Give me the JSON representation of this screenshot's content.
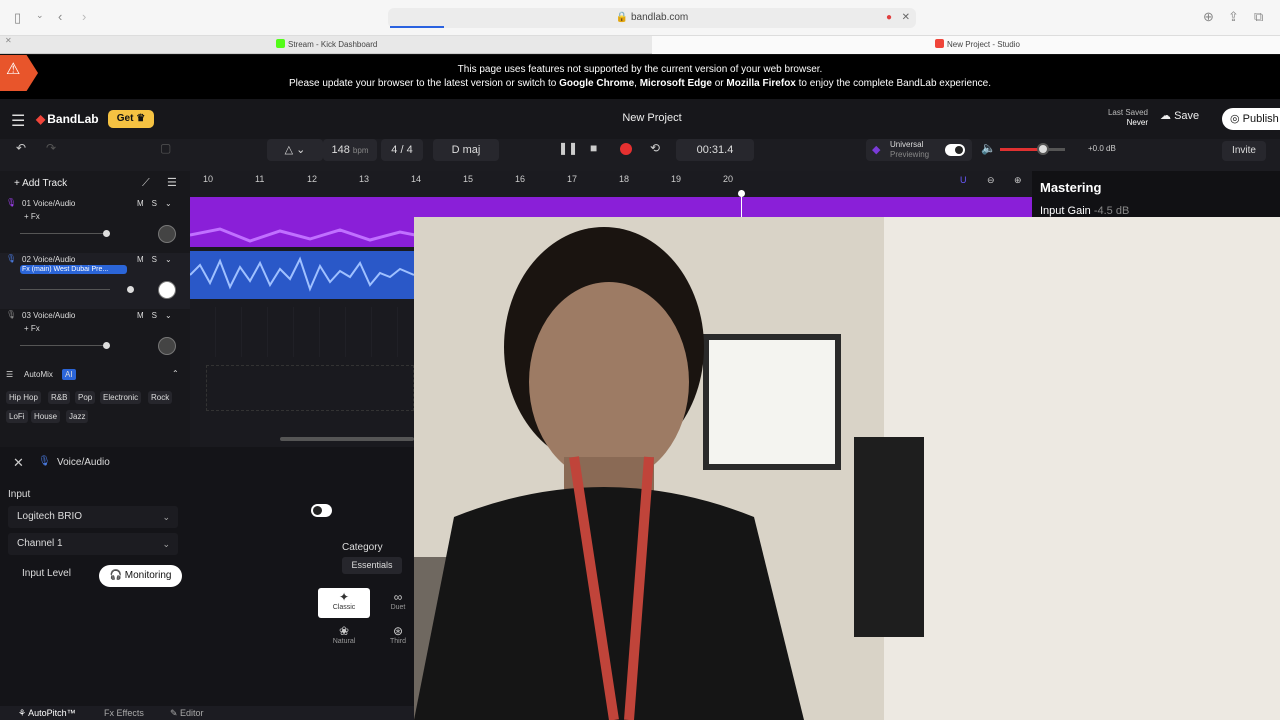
{
  "browser": {
    "url": "bandlab.com",
    "tabs": [
      {
        "title": "Stream - Kick Dashboard",
        "color": "#53fc18"
      },
      {
        "title": "New Project - Studio",
        "color": "#f0453a"
      }
    ]
  },
  "banner": {
    "line1": "This page uses features not supported by the current version of your web browser.",
    "line2_prefix": "Please update your browser to the latest version or switch to",
    "chrome": "Google Chrome",
    "edge": "Microsoft Edge",
    "or": "or",
    "firefox": "Mozilla Firefox",
    "line2_suffix": "to enjoy the complete BandLab experience."
  },
  "topbar": {
    "logo": "BandLab",
    "get_label": "Get",
    "project_title": "New Project",
    "last_saved_label": "Last Saved",
    "last_saved_value": "Never",
    "save_label": "Save",
    "publish_label": "Publish"
  },
  "transport": {
    "bpm": "148",
    "bpm_unit": "bpm",
    "time_sig_num": "4",
    "time_sig_den": "4",
    "key": "D maj",
    "time": "00:31.4",
    "universal_label": "Universal",
    "universal_sub": "Previewing",
    "master_gain": "+0.0 dB",
    "invite_label": "Invite",
    "volume_level": 0.65
  },
  "tracks_panel": {
    "add_track_label": "Add Track",
    "ruler": [
      "10",
      "11",
      "12",
      "13",
      "14",
      "15",
      "16",
      "17",
      "18",
      "19",
      "20"
    ],
    "tracks": [
      {
        "name": "01  Voice/Audio",
        "fx": "+ Fx",
        "fader": 0.95
      },
      {
        "name": "02  Voice/Audio",
        "fx": "Fx (main) West Dubai Pre...",
        "fader": 1.0
      },
      {
        "name": "03  Voice/Audio",
        "fx": "+ Fx",
        "fader": 0.95
      }
    ],
    "mute": "M",
    "solo": "S",
    "automix_label": "AutoMix",
    "ai_badge": "AI",
    "genres": [
      "Hip Hop",
      "R&B",
      "Pop",
      "Electronic",
      "Rock",
      "LoFi",
      "House",
      "Jazz"
    ]
  },
  "mastering": {
    "title": "Mastering",
    "input_gain_label": "Input Gain",
    "input_gain_value": "-4.5 dB"
  },
  "bottom_panel": {
    "track_name": "Voice/Audio",
    "input_label": "Input",
    "device": "Logitech BRIO",
    "channel": "Channel 1",
    "input_level_label": "Input Level",
    "monitoring_label": "Monitoring",
    "category_label": "Category",
    "essentials_label": "Essentials",
    "styles": [
      {
        "label": "Classic"
      },
      {
        "label": "Duet"
      },
      {
        "label": "Natural"
      },
      {
        "label": "Third"
      }
    ],
    "tabs": [
      "AutoPitch™",
      "Effects",
      "Editor"
    ]
  }
}
